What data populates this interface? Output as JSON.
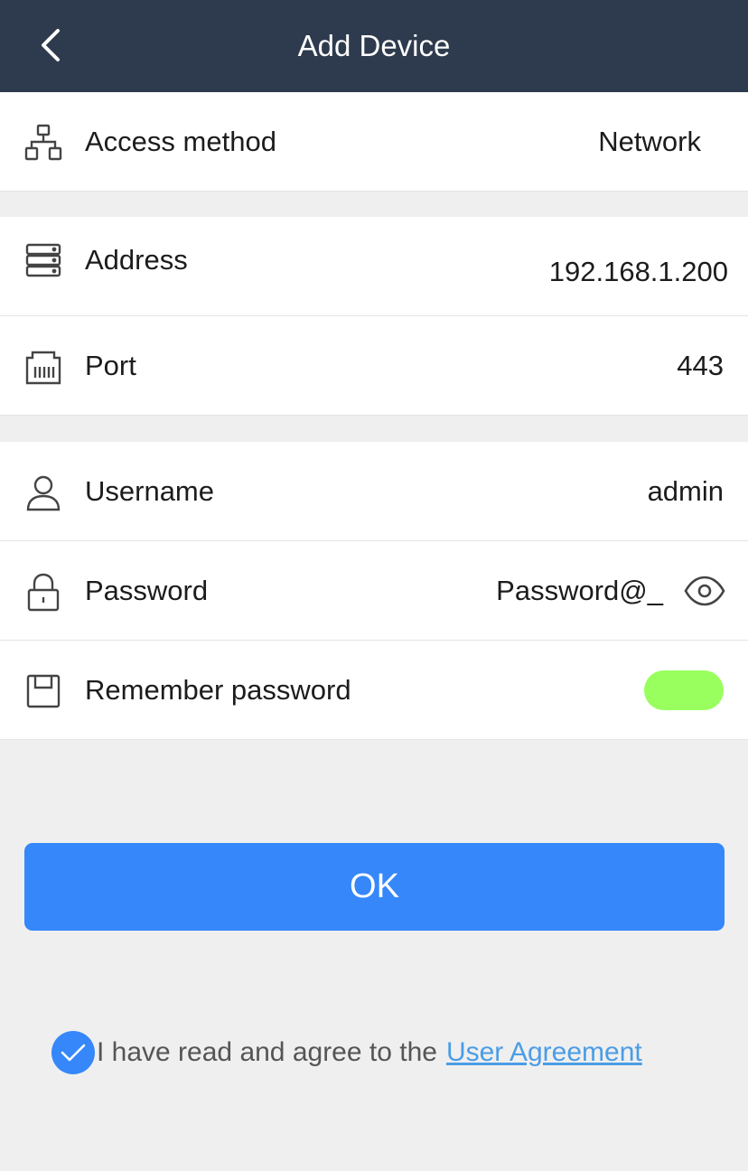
{
  "colors": {
    "header_bg": "#2e3a4d",
    "accent": "#3587fa",
    "toggle_on": "#98ff5f",
    "link": "#4a9de6",
    "icon": "#444444"
  },
  "header": {
    "title": "Add Device",
    "back_icon": "chevron-left-icon"
  },
  "groups": [
    {
      "rows": [
        {
          "icon": "network-icon",
          "label": "Access method",
          "value": "Network"
        }
      ]
    },
    {
      "rows": [
        {
          "icon": "server-icon",
          "label": "Address",
          "value": "192.168.1.200"
        },
        {
          "icon": "port-icon",
          "label": "Port",
          "value": "443"
        }
      ]
    },
    {
      "rows": [
        {
          "icon": "user-icon",
          "label": "Username",
          "value": "admin"
        },
        {
          "icon": "lock-icon",
          "label": "Password",
          "value": "Password@_",
          "action_icon": "eye-icon"
        },
        {
          "icon": "floppy-disk-icon",
          "label": "Remember password",
          "toggle_on": true
        }
      ]
    }
  ],
  "ok_button": {
    "label": "OK"
  },
  "agreement": {
    "checked": true,
    "text": "I have read and agree to the",
    "link_text": "User Agreement"
  }
}
